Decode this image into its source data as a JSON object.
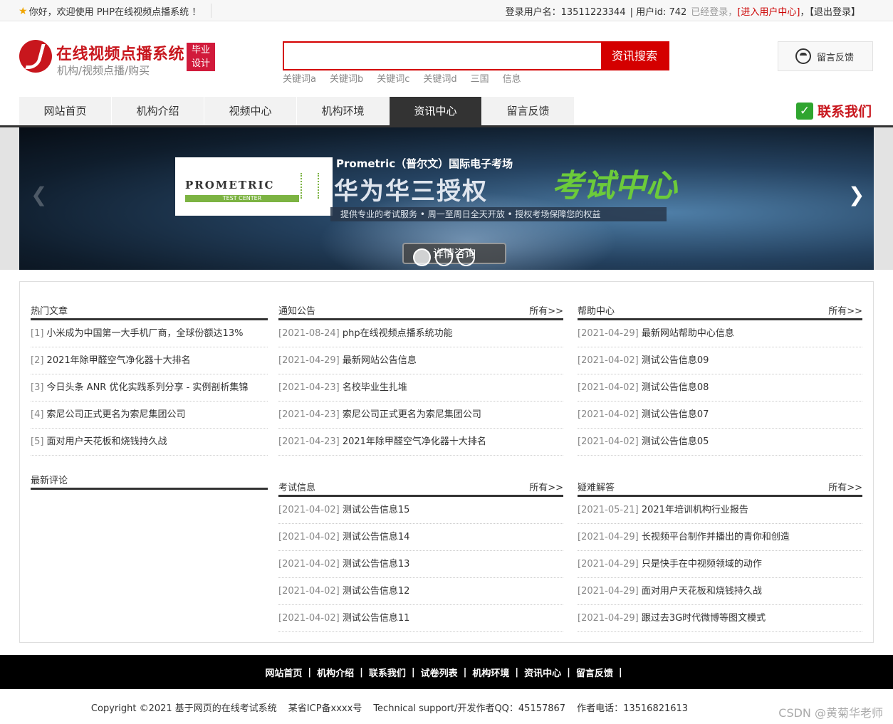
{
  "topbar": {
    "welcome": "你好，欢迎使用 PHP在线视频点播系统 ！",
    "login_user": "登录用户名：13511223344",
    "user_id": "| 用户id: 742",
    "status": "已经登录，",
    "enter_center": "[进入用户中心]",
    "comma": "，",
    "logout": "【退出登录】"
  },
  "header": {
    "title": "在线视频点播系统",
    "subtitle": "机构/视频点播/购买",
    "badge_line1": "毕业",
    "badge_line2": "设计",
    "search_value": "",
    "search_button": "资讯搜索",
    "keywords": [
      "关键词a",
      "关键词b",
      "关键词c",
      "关键词d",
      "三国",
      "信息"
    ],
    "feedback": "留言反馈"
  },
  "nav": {
    "items": [
      {
        "label": "网站首页",
        "active": false
      },
      {
        "label": "机构介绍",
        "active": false
      },
      {
        "label": "视频中心",
        "active": false
      },
      {
        "label": "机构环境",
        "active": false
      },
      {
        "label": "资讯中心",
        "active": true
      },
      {
        "label": "留言反馈",
        "active": false
      }
    ],
    "contact": "联系我们"
  },
  "banner": {
    "brand": "PROMETRIC",
    "brand_sub": "TEST CENTER",
    "line1": "Prometric（普尔文）国际电子考场",
    "line2a": "华为华三授权",
    "line2b": "考试中心",
    "desc": "提供专业的考试服务 • 周一至周日全天开放 • 授权考场保障您的权益",
    "button": "详情咨询",
    "active_slide": 0,
    "slide_count": 3
  },
  "panels": {
    "hot": {
      "title": "热门文章",
      "items": [
        {
          "pre": "[1] ",
          "text": "小米成为中国第一大手机厂商，全球份额达13%"
        },
        {
          "pre": "[2] ",
          "text": "2021年除甲醛空气净化器十大排名"
        },
        {
          "pre": "[3] ",
          "text": "今日头条 ANR 优化实践系列分享 - 实例剖析集锦"
        },
        {
          "pre": "[4] ",
          "text": "索尼公司正式更名为索尼集团公司"
        },
        {
          "pre": "[5] ",
          "text": "面对用户天花板和烧钱持久战"
        }
      ]
    },
    "comments": {
      "title": "最新评论"
    },
    "notice": {
      "title": "通知公告",
      "more": "所有>>",
      "items": [
        {
          "pre": "[2021-08-24] ",
          "text": "php在线视频点播系统功能"
        },
        {
          "pre": "[2021-04-29] ",
          "text": "最新网站公告信息"
        },
        {
          "pre": "[2021-04-23] ",
          "text": "名校毕业生扎堆"
        },
        {
          "pre": "[2021-04-23] ",
          "text": "索尼公司正式更名为索尼集团公司"
        },
        {
          "pre": "[2021-04-23] ",
          "text": "2021年除甲醛空气净化器十大排名"
        }
      ]
    },
    "exam": {
      "title": "考试信息",
      "more": "所有>>",
      "items": [
        {
          "pre": "[2021-04-02] ",
          "text": "测试公告信息15"
        },
        {
          "pre": "[2021-04-02] ",
          "text": "测试公告信息14"
        },
        {
          "pre": "[2021-04-02] ",
          "text": "测试公告信息13"
        },
        {
          "pre": "[2021-04-02] ",
          "text": "测试公告信息12"
        },
        {
          "pre": "[2021-04-02] ",
          "text": "测试公告信息11"
        }
      ]
    },
    "help": {
      "title": "帮助中心",
      "more": "所有>>",
      "items": [
        {
          "pre": "[2021-04-29] ",
          "text": "最新网站帮助中心信息"
        },
        {
          "pre": "[2021-04-02] ",
          "text": "测试公告信息09"
        },
        {
          "pre": "[2021-04-02] ",
          "text": "测试公告信息08"
        },
        {
          "pre": "[2021-04-02] ",
          "text": "测试公告信息07"
        },
        {
          "pre": "[2021-04-02] ",
          "text": "测试公告信息05"
        }
      ]
    },
    "faq": {
      "title": "疑难解答",
      "more": "所有>>",
      "items": [
        {
          "pre": "[2021-05-21] ",
          "text": "2021年培训机构行业报告"
        },
        {
          "pre": "[2021-04-29] ",
          "text": "长视频平台制作并播出的青你和创造"
        },
        {
          "pre": "[2021-04-29] ",
          "text": "只是快手在中视频领域的动作"
        },
        {
          "pre": "[2021-04-29] ",
          "text": "面对用户天花板和烧钱持久战"
        },
        {
          "pre": "[2021-04-29] ",
          "text": "跟过去3G时代微博等图文模式"
        }
      ]
    }
  },
  "footer": {
    "links": [
      "网站首页",
      "机构介绍",
      "联系我们",
      "试卷列表",
      "机构环境",
      "资讯中心",
      "留言反馈"
    ],
    "separator": "|",
    "copyright": "Copyright ©2021 基于网页的在线考试系统",
    "icp": "某省ICP备xxxx号",
    "support": "Technical support/开发作者QQ：45157867",
    "phone": "作者电话：13516821613"
  },
  "watermark": "CSDN @黄菊华老师"
}
